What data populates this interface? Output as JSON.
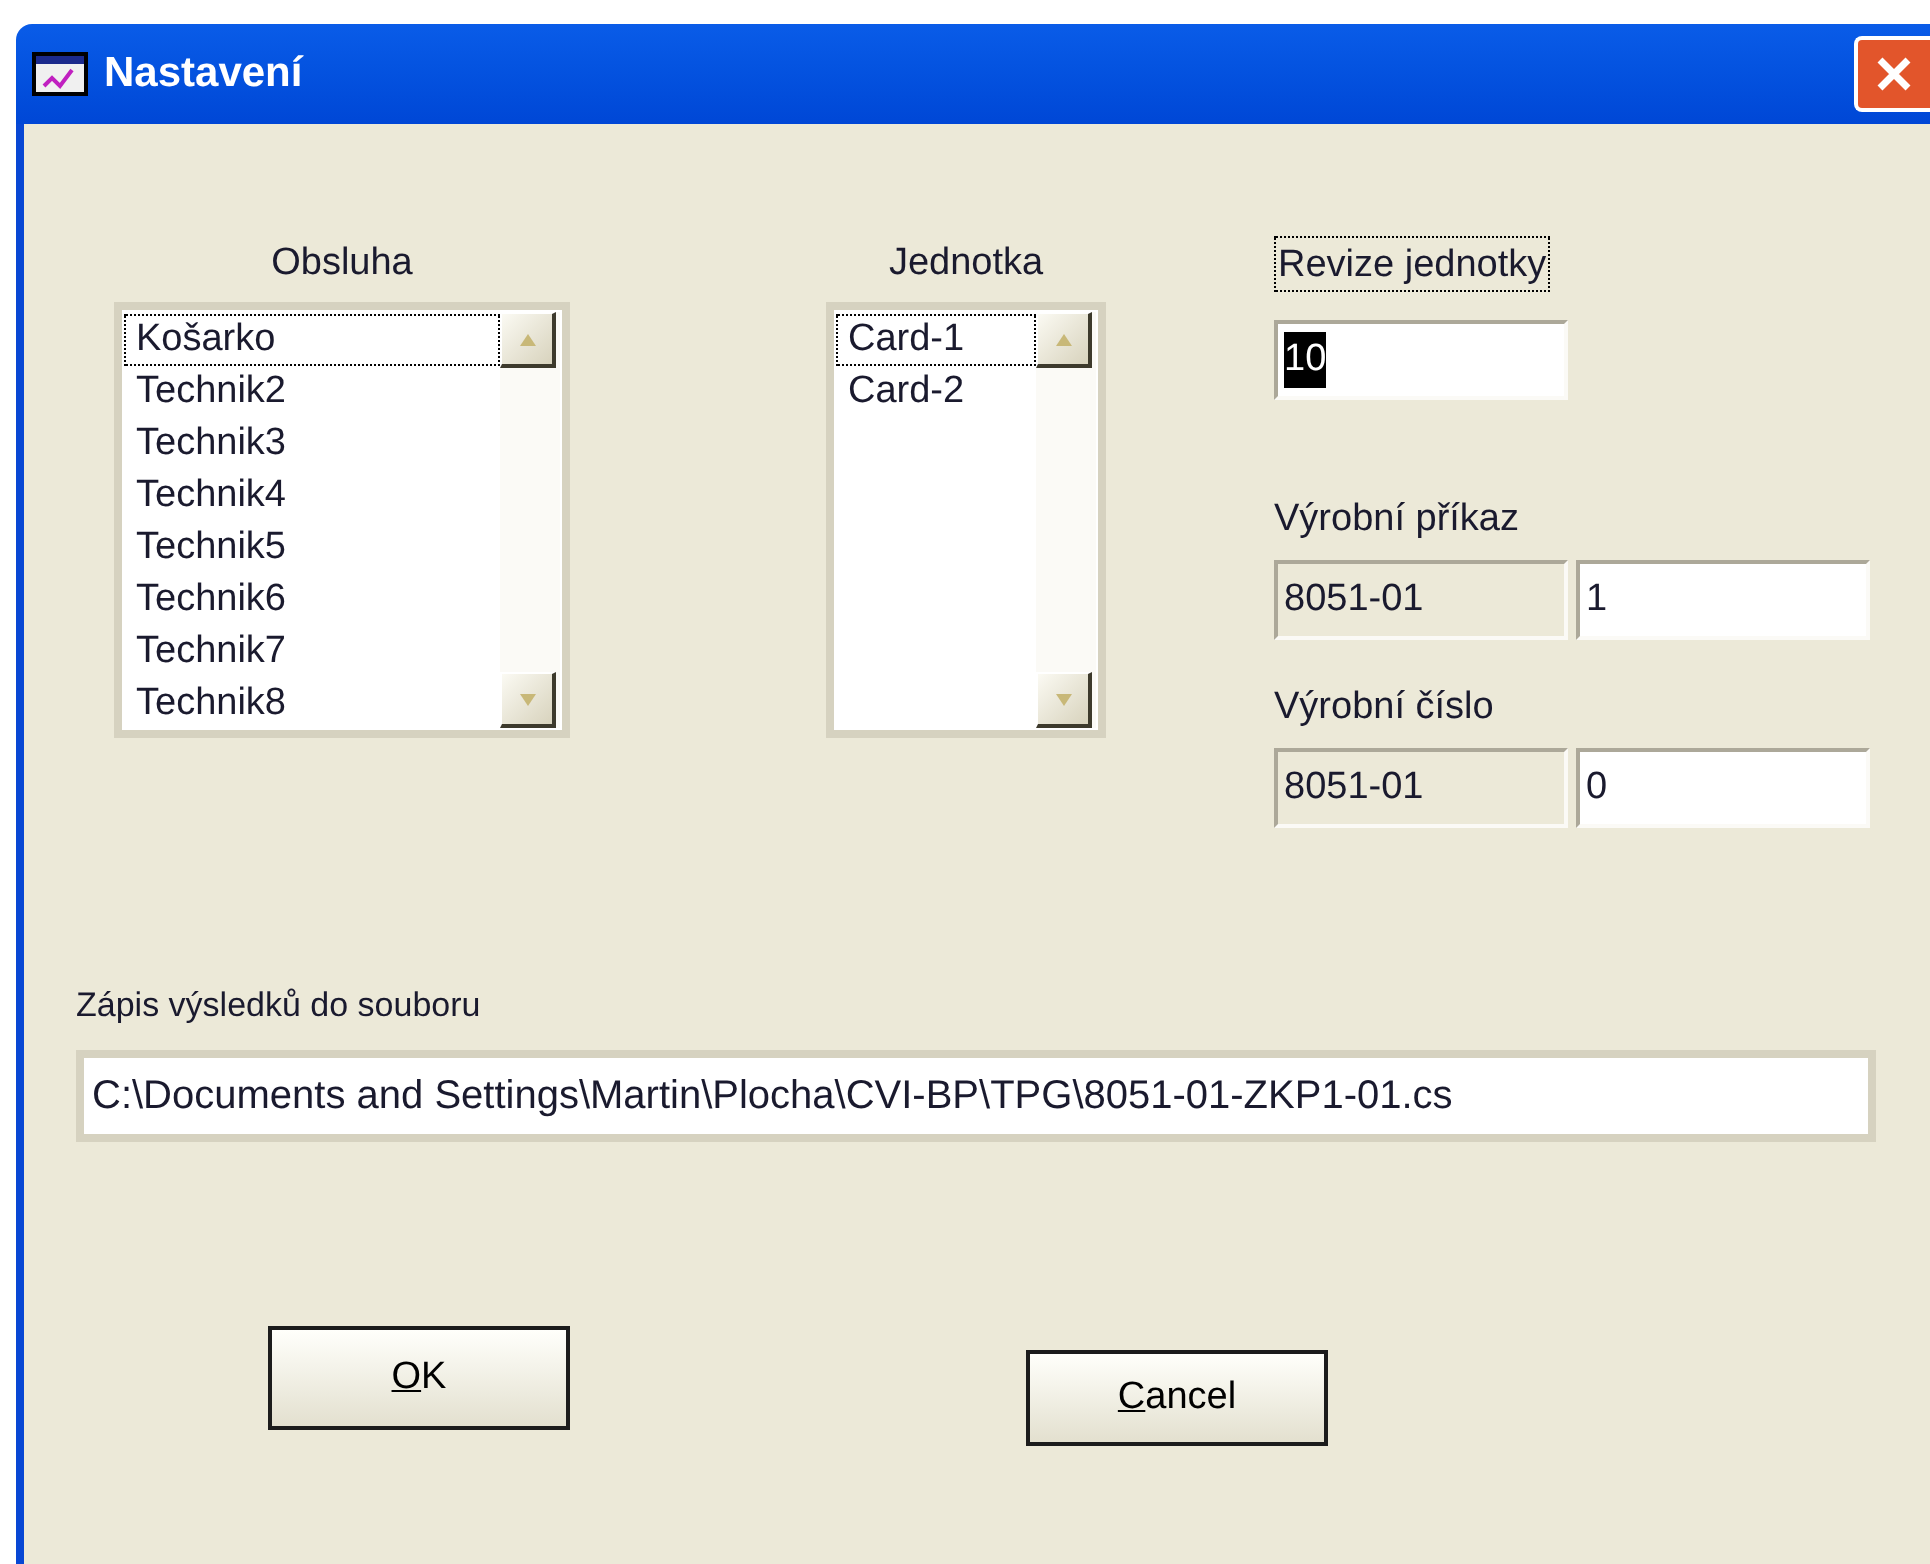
{
  "window": {
    "title": "Nastavení"
  },
  "operator_list": {
    "label": "Obsluha",
    "items": [
      {
        "text": "Košarko",
        "selected": true
      },
      {
        "text": "Technik2",
        "selected": false
      },
      {
        "text": "Technik3",
        "selected": false
      },
      {
        "text": "Technik4",
        "selected": false
      },
      {
        "text": "Technik5",
        "selected": false
      },
      {
        "text": "Technik6",
        "selected": false
      },
      {
        "text": "Technik7",
        "selected": false
      },
      {
        "text": "Technik8",
        "selected": false
      }
    ]
  },
  "unit_list": {
    "label": "Jednotka",
    "items": [
      {
        "text": "Card-1",
        "selected": true
      },
      {
        "text": "Card-2",
        "selected": false
      }
    ]
  },
  "unit_revision": {
    "label": "Revize jednotky",
    "label_focused": true,
    "value": "10",
    "text_selected": true
  },
  "production_order": {
    "label": "Výrobní příkaz",
    "prefix": "8051-01",
    "value": "1"
  },
  "production_number": {
    "label": "Výrobní číslo",
    "prefix": "8051-01",
    "value": "0"
  },
  "output_file": {
    "label": "Zápis výsledků do souboru",
    "value": "C:\\Documents and Settings\\Martin\\Plocha\\CVI-BP\\TPG\\8051-01-ZKP1-01.cs"
  },
  "buttons": [
    {
      "label": "OK",
      "first_letter_underlined": true
    },
    {
      "label": "Cancel",
      "first_letter_underlined": true
    }
  ]
}
